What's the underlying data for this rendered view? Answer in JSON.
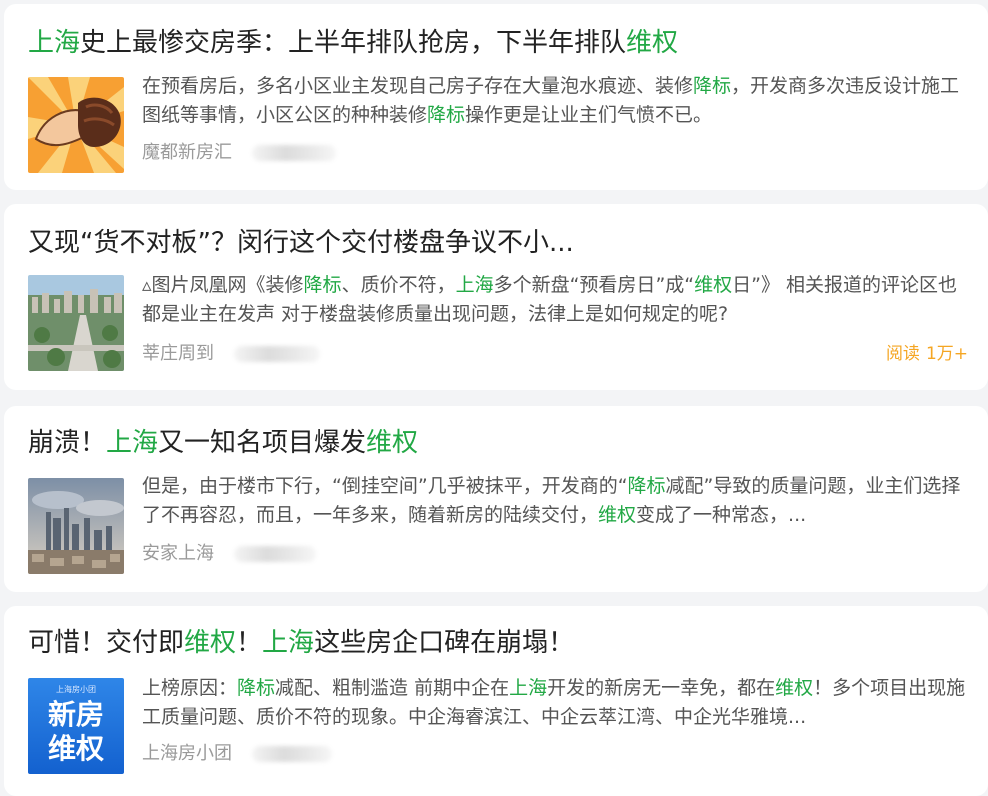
{
  "feed": {
    "items": [
      {
        "title": [
          {
            "t": "上海",
            "hl": true
          },
          {
            "t": "史上最惨交房季：上半年排队抢房，下半年排队",
            "hl": false
          },
          {
            "t": "维权",
            "hl": true
          }
        ],
        "snippet": [
          {
            "t": "在预看房后，多名小区业主发现自己房子存在大量泡水痕迹、装修",
            "hl": false
          },
          {
            "t": "降标",
            "hl": true
          },
          {
            "t": "，开发商多次违反设计施工图纸等事情，小区公区的种种装修",
            "hl": false
          },
          {
            "t": "降标",
            "hl": true
          },
          {
            "t": "操作更是让业主们气愤不已。",
            "hl": false
          }
        ],
        "source": "魔都新房汇",
        "reads_label": "",
        "reads_value": "",
        "thumb": "fist-illustration"
      },
      {
        "title": [
          {
            "t": "又现“货不对板”？闵行这个交付楼盘争议不小...",
            "hl": false
          }
        ],
        "snippet": [
          {
            "t": "▵图片凤凰网《装修",
            "hl": false
          },
          {
            "t": "降标",
            "hl": true
          },
          {
            "t": "、质价不符，",
            "hl": false
          },
          {
            "t": "上海",
            "hl": true
          },
          {
            "t": "多个新盘“预看房日”成“",
            "hl": false
          },
          {
            "t": "维权",
            "hl": true
          },
          {
            "t": "日”》 相关报道的评论区也都是业主在发声 对于楼盘装修质量出现问题，法律上是如何规定的呢?",
            "hl": false
          }
        ],
        "source": "莘庄周到",
        "reads_label": "阅读",
        "reads_value": "1万+",
        "thumb": "aerial-city-photo"
      },
      {
        "title": [
          {
            "t": "崩溃！",
            "hl": false
          },
          {
            "t": "上海",
            "hl": true
          },
          {
            "t": "又一知名项目爆发",
            "hl": false
          },
          {
            "t": "维权",
            "hl": true
          }
        ],
        "snippet": [
          {
            "t": "但是，由于楼市下行，“倒挂空间”几乎被抹平，开发商的“",
            "hl": false
          },
          {
            "t": "降标",
            "hl": true
          },
          {
            "t": "减配”导致的质量问题，业主们选择了不再容忍，而且，一年多来，随着新房的陆续交付，",
            "hl": false
          },
          {
            "t": "维权",
            "hl": true
          },
          {
            "t": "变成了一种常态，...",
            "hl": false
          }
        ],
        "source": "安家上海",
        "reads_label": "",
        "reads_value": "",
        "thumb": "skyline-photo"
      },
      {
        "title": [
          {
            "t": "可惜！交付即",
            "hl": false
          },
          {
            "t": "维权",
            "hl": true
          },
          {
            "t": "！",
            "hl": false
          },
          {
            "t": "上海",
            "hl": true
          },
          {
            "t": "这些房企口碑在崩塌！",
            "hl": false
          }
        ],
        "snippet": [
          {
            "t": "上榜原因：",
            "hl": false
          },
          {
            "t": "降标",
            "hl": true
          },
          {
            "t": "减配、粗制滥造 前期中企在",
            "hl": false
          },
          {
            "t": "上海",
            "hl": true
          },
          {
            "t": "开发的新房无一幸免，都在",
            "hl": false
          },
          {
            "t": "维权",
            "hl": true
          },
          {
            "t": "！多个项目出现施工质量问题、质价不符的现象。中企海睿滨江、中企云萃江湾、中企光华雅境...",
            "hl": false
          }
        ],
        "source": "上海房小团",
        "reads_label": "",
        "reads_value": "",
        "thumb": "blue-text-card",
        "thumb_text": {
          "top": "上海房小团",
          "line1": "新房",
          "line2": "维权"
        }
      }
    ],
    "highlight_color": "#22a845",
    "reads_color": "#f5a623"
  }
}
